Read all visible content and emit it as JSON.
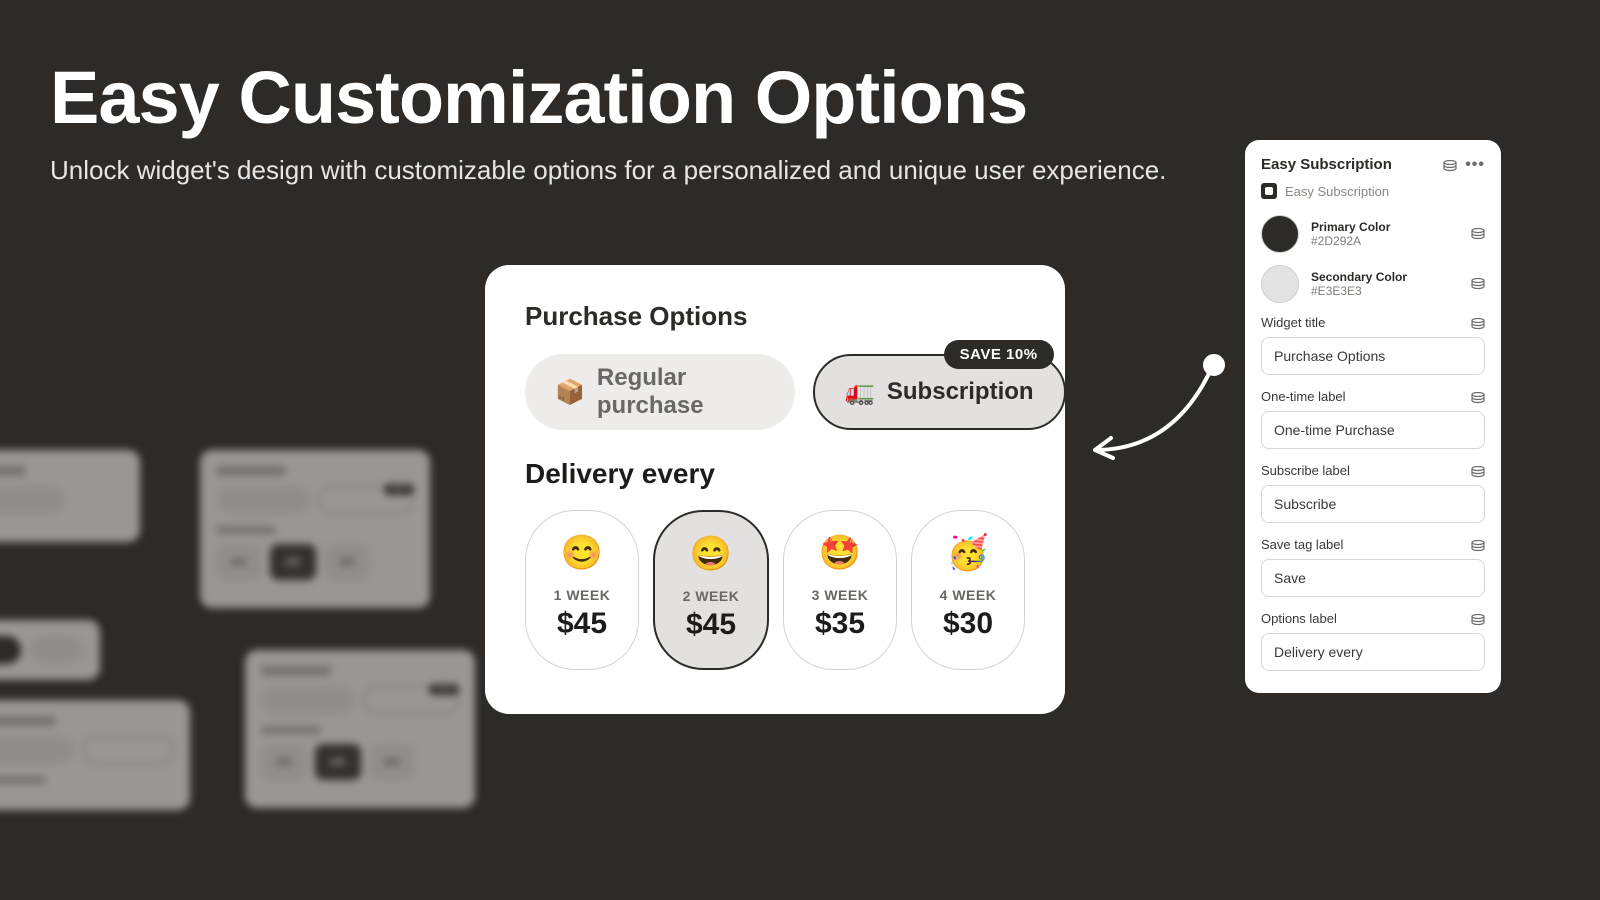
{
  "hero": {
    "title": "Easy Customization Options",
    "subtitle": "Unlock widget's design with customizable options for a personalized and unique user experience."
  },
  "widget": {
    "title": "Purchase Options",
    "regular_emoji": "📦",
    "regular_label": "Regular purchase",
    "sub_emoji": "🚛",
    "sub_label": "Subscription",
    "save_badge": "SAVE 10%",
    "delivery_title": "Delivery every",
    "tiers": [
      {
        "emoji": "😊",
        "weeks": "1 WEEK",
        "price": "$45"
      },
      {
        "emoji": "😄",
        "weeks": "2 WEEK",
        "price": "$45"
      },
      {
        "emoji": "🤩",
        "weeks": "3 WEEK",
        "price": "$35"
      },
      {
        "emoji": "🥳",
        "weeks": "4 WEEK",
        "price": "$30"
      }
    ]
  },
  "panel": {
    "title": "Easy Subscription",
    "app_name": "Easy Subscription",
    "primary_label": "Primary Color",
    "primary_hex": "#2D292A",
    "secondary_label": "Secondary Color",
    "secondary_hex": "#E3E3E3",
    "fields": {
      "widget_title_label": "Widget title",
      "widget_title_value": "Purchase Options",
      "onetime_label": "One-time label",
      "onetime_value": "One-time Purchase",
      "subscribe_label": "Subscribe label",
      "subscribe_value": "Subscribe",
      "save_tag_label": "Save tag label",
      "save_tag_value": "Save",
      "options_label": "Options label",
      "options_value": "Delivery every"
    }
  }
}
